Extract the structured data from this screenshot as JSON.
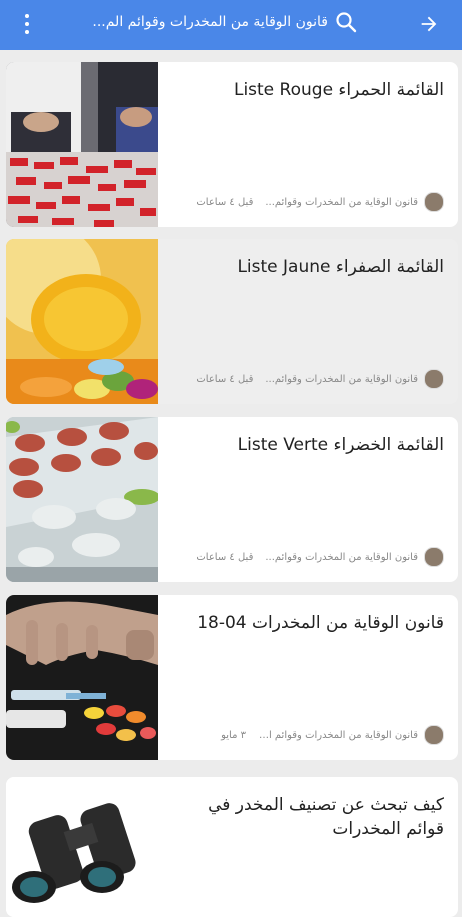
{
  "header": {
    "title": "قانون الوقاية من المخدرات وقوائم الم...",
    "back_icon": "arrow-right-icon",
    "search_icon": "search-icon",
    "more_icon": "more-vert-icon",
    "color": "#4a87e8"
  },
  "articles": [
    {
      "title": "القائمة الحمراء Liste Rouge",
      "source": "قانون الوقاية من المخدرات وقوائم...",
      "time": "قبل ٤ ساعات"
    },
    {
      "title": "القائمة الصفراء Liste Jaune",
      "source": "قانون الوقاية من المخدرات وقوائم...",
      "time": "قبل ٤ ساعات"
    },
    {
      "title": "القائمة الخضراء Liste Verte",
      "source": "قانون الوقاية من المخدرات وقوائم...",
      "time": "قبل ٤ ساعات"
    },
    {
      "title": "قانون الوقاية من المخدرات 04-18",
      "source": "قانون الوقاية من المخدرات وقوائم المخدر...",
      "time": "٣ مايو"
    },
    {
      "title": "كيف تبحث عن تصنيف المخدر في قوائم المخدرات",
      "source": "",
      "time": ""
    }
  ]
}
